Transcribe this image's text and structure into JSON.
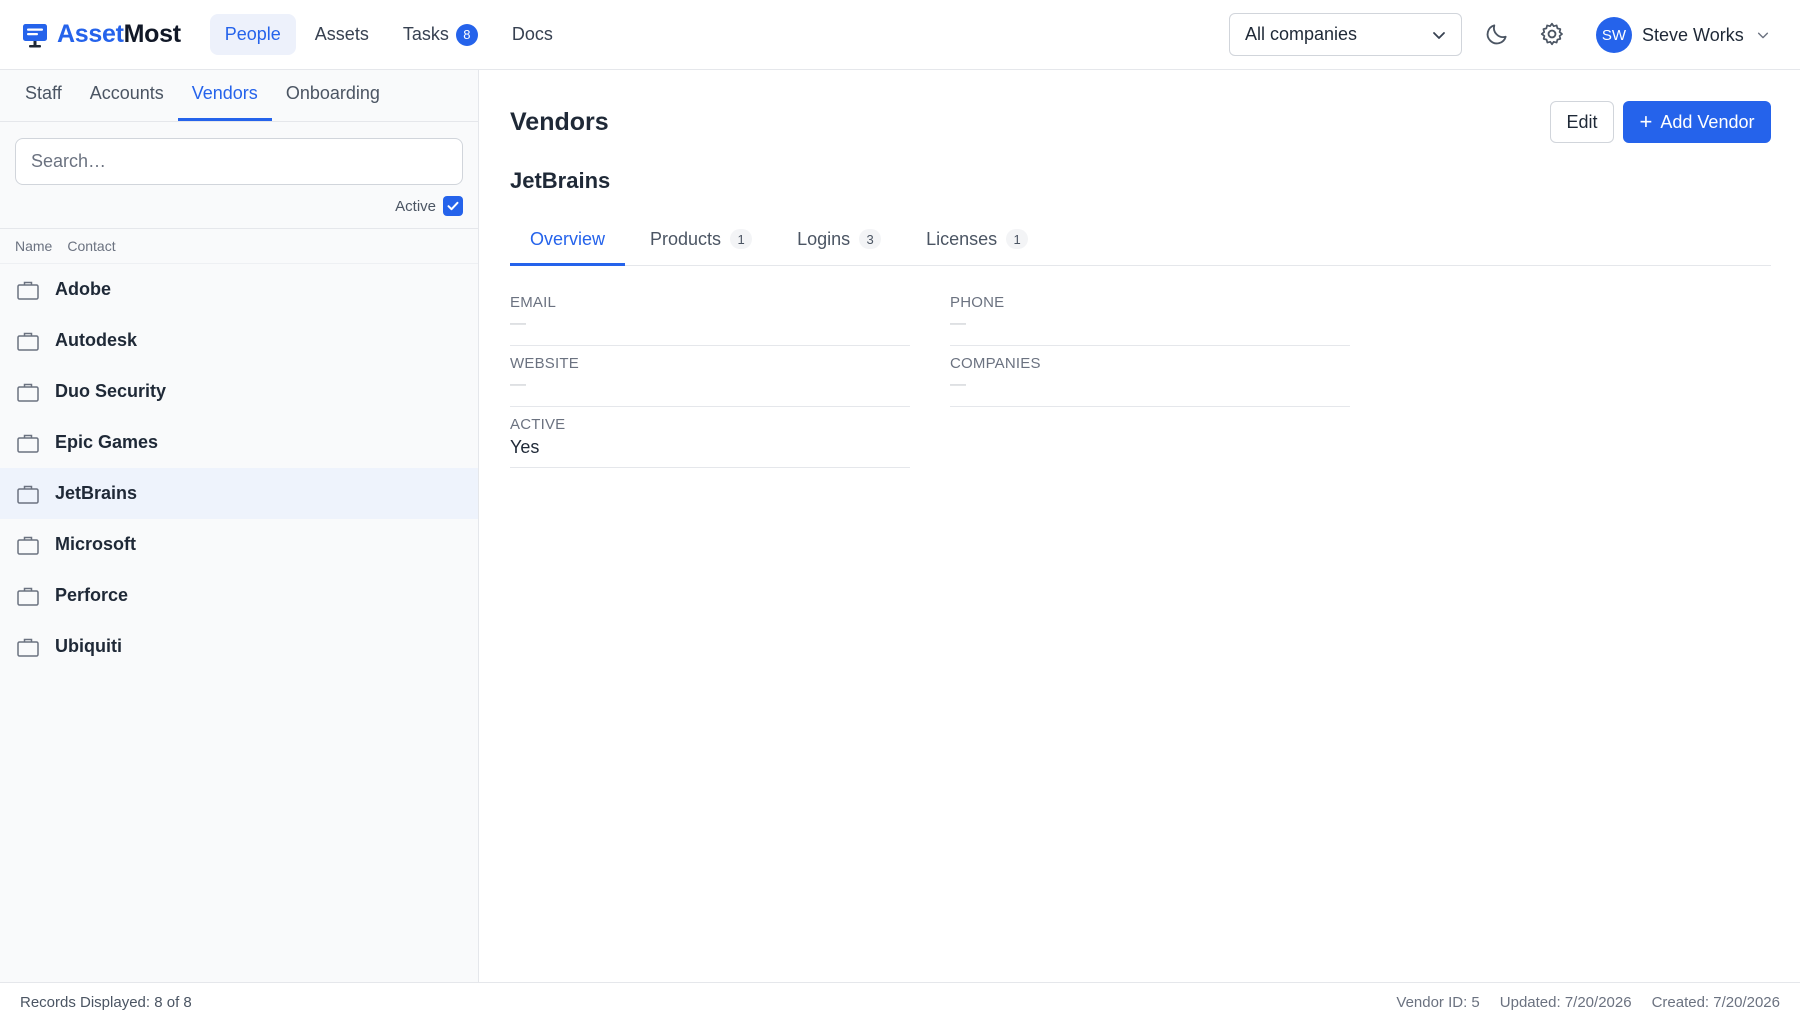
{
  "brand": {
    "name_part1": "Asset",
    "name_part2": "Most"
  },
  "nav": {
    "items": [
      {
        "label": "People"
      },
      {
        "label": "Assets"
      },
      {
        "label": "Tasks",
        "badge": "8"
      },
      {
        "label": "Docs"
      }
    ]
  },
  "company_select": {
    "value": "All companies"
  },
  "user": {
    "initials": "SW",
    "name": "Steve Works"
  },
  "sidebar": {
    "tabs": [
      {
        "label": "Staff"
      },
      {
        "label": "Accounts"
      },
      {
        "label": "Vendors"
      },
      {
        "label": "Onboarding"
      }
    ],
    "search_placeholder": "Search…",
    "active_filter_label": "Active",
    "columns": {
      "name": "Name",
      "contact": "Contact"
    },
    "vendors": [
      {
        "name": "Adobe"
      },
      {
        "name": "Autodesk"
      },
      {
        "name": "Duo Security"
      },
      {
        "name": "Epic Games"
      },
      {
        "name": "JetBrains"
      },
      {
        "name": "Microsoft"
      },
      {
        "name": "Perforce"
      },
      {
        "name": "Ubiquiti"
      }
    ]
  },
  "main": {
    "title": "Vendors",
    "edit_label": "Edit",
    "add_label": "Add Vendor",
    "record_name": "JetBrains",
    "tabs": [
      {
        "label": "Overview"
      },
      {
        "label": "Products",
        "count": "1"
      },
      {
        "label": "Logins",
        "count": "3"
      },
      {
        "label": "Licenses",
        "count": "1"
      }
    ],
    "fields": {
      "email": {
        "label": "EMAIL",
        "value": "—"
      },
      "phone": {
        "label": "PHONE",
        "value": "—"
      },
      "website": {
        "label": "WEBSITE",
        "value": "—"
      },
      "companies": {
        "label": "COMPANIES",
        "value": "—"
      },
      "active": {
        "label": "ACTIVE",
        "value": "Yes"
      }
    }
  },
  "footer": {
    "records": "Records Displayed: 8 of 8",
    "vendor_id": "Vendor ID: 5",
    "updated": "Updated: 7/20/2026",
    "created": "Created: 7/20/2026"
  },
  "colors": {
    "accent": "#2563eb",
    "selected_row": "#eef3fc",
    "sidebar_bg": "#f9fafb"
  }
}
